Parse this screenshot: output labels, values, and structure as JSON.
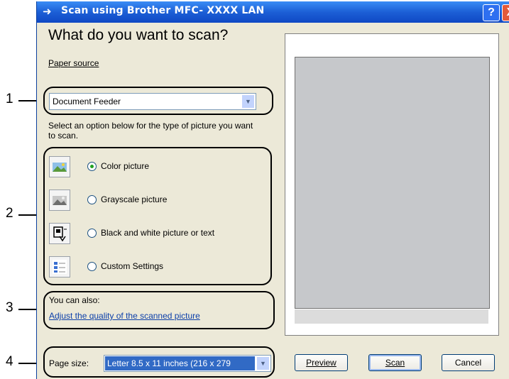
{
  "callouts": [
    "1",
    "2",
    "3",
    "4"
  ],
  "window": {
    "title": "Scan using Brother MFC- XXXX  LAN",
    "help_label": "?",
    "close_label": "X"
  },
  "left": {
    "heading": "What do you want to scan?",
    "paper_source": {
      "label": "Paper source",
      "value": "Document Feeder"
    },
    "instruction": "Select an option below for the type of picture you want to scan.",
    "options": [
      {
        "label": "Color picture",
        "selected": true,
        "icon": "color-picture-icon"
      },
      {
        "label": "Grayscale picture",
        "selected": false,
        "icon": "grayscale-picture-icon"
      },
      {
        "label": "Black and white picture or text",
        "selected": false,
        "icon": "black-white-text-icon"
      },
      {
        "label": "Custom Settings",
        "selected": false,
        "icon": "custom-settings-icon"
      }
    ],
    "also_label": "You can also:",
    "adjust_link": "Adjust the quality of the scanned picture",
    "page_size": {
      "label": "Page size:",
      "value": "Letter 8.5 x 11 inches (216 x 279"
    }
  },
  "buttons": {
    "preview": "Preview",
    "scan": "Scan",
    "cancel": "Cancel"
  },
  "colors": {
    "titlebar": "#1c5fd6",
    "dialog_bg": "#ece9d8",
    "preview_area": "#c6c8cb",
    "link": "#0c3fa9",
    "selection": "#316ac5"
  }
}
